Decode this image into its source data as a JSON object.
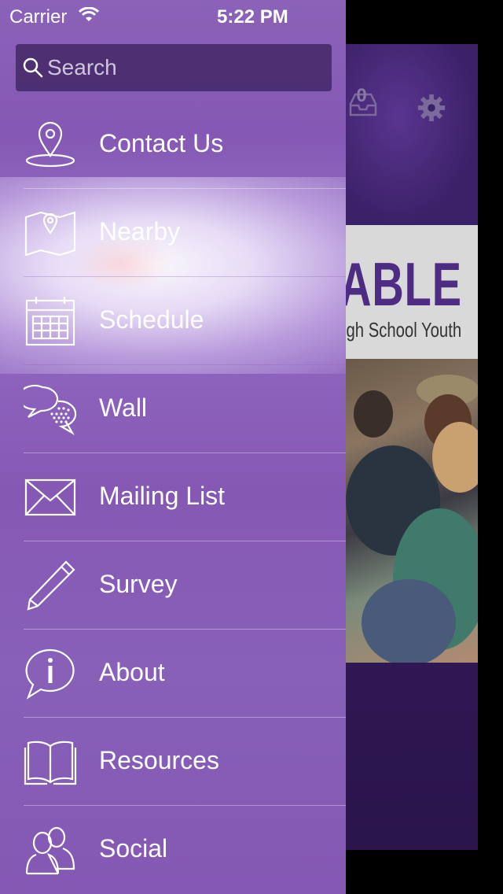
{
  "status_bar": {
    "carrier": "Carrier",
    "time": "5:22 PM"
  },
  "search": {
    "placeholder": "Search",
    "value": ""
  },
  "menu": {
    "items": [
      {
        "label": "Contact Us",
        "icon": "location-pin-icon"
      },
      {
        "label": "Nearby",
        "icon": "map-icon"
      },
      {
        "label": "Schedule",
        "icon": "calendar-icon"
      },
      {
        "label": "Wall",
        "icon": "chat-bubbles-icon"
      },
      {
        "label": "Mailing List",
        "icon": "envelope-icon"
      },
      {
        "label": "Survey",
        "icon": "pencil-icon"
      },
      {
        "label": "About",
        "icon": "info-bubble-icon"
      },
      {
        "label": "Resources",
        "icon": "book-icon"
      },
      {
        "label": "Social",
        "icon": "people-icon"
      }
    ]
  },
  "background_app": {
    "inbox_count": "0",
    "banner_title": "ABLE",
    "banner_subtitle": "igh School Youth"
  },
  "colors": {
    "drawer_purple": "#8458b4",
    "app_dark_purple": "#3a1f63",
    "banner_text": "#4e2c83"
  }
}
